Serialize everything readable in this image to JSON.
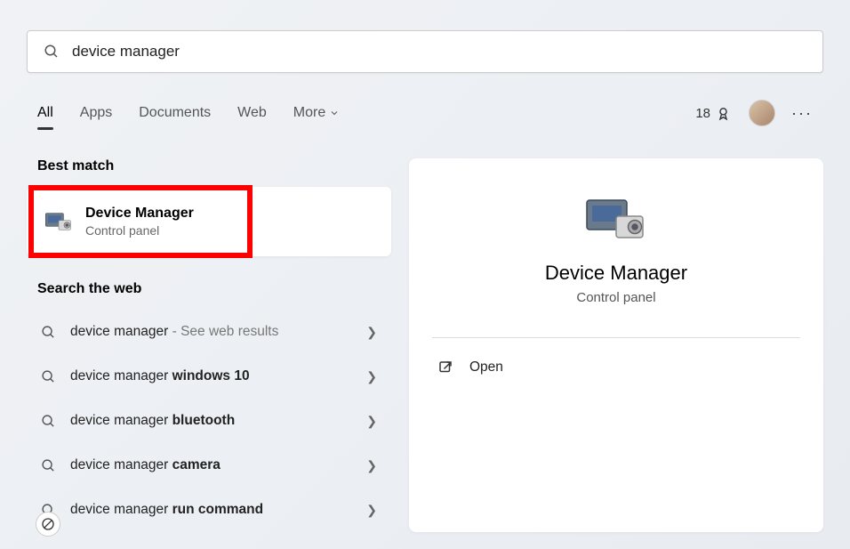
{
  "search": {
    "query": "device manager"
  },
  "tabs": {
    "all": "All",
    "apps": "Apps",
    "documents": "Documents",
    "web": "Web",
    "more": "More"
  },
  "rewards": {
    "points": "18"
  },
  "sections": {
    "best_match": "Best match",
    "search_web": "Search the web"
  },
  "best_match": {
    "title": "Device Manager",
    "subtitle": "Control panel"
  },
  "web_results": [
    {
      "prefix": "device manager",
      "bold": "",
      "suffix": " - See web results"
    },
    {
      "prefix": "device manager ",
      "bold": "windows 10",
      "suffix": ""
    },
    {
      "prefix": "device manager ",
      "bold": "bluetooth",
      "suffix": ""
    },
    {
      "prefix": "device manager ",
      "bold": "camera",
      "suffix": ""
    },
    {
      "prefix": "device manager ",
      "bold": "run command",
      "suffix": ""
    }
  ],
  "detail": {
    "title": "Device Manager",
    "subtitle": "Control panel",
    "open": "Open"
  }
}
